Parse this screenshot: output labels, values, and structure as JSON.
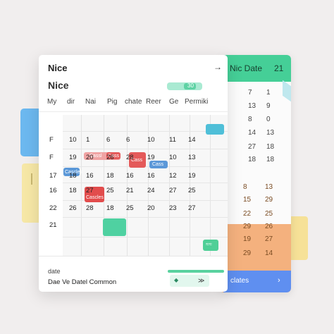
{
  "title": "Nice",
  "subtitle": "Nice",
  "header_arrow": "→",
  "pill_text": "30",
  "weekdays": [
    "My",
    "dir",
    "Nai",
    "Pig",
    "chate",
    "Reer",
    "Ge",
    "Permiki"
  ],
  "rows": [
    [
      "F",
      "10",
      "1",
      "6",
      "6",
      "10",
      "11",
      "14"
    ],
    [
      "F",
      "19",
      "20",
      "26",
      "28",
      "19",
      "10",
      "13"
    ],
    [
      "17",
      "18",
      "16",
      "18",
      "16",
      "16",
      "12",
      "19"
    ],
    [
      "16",
      "18",
      "27",
      "25",
      "21",
      "24",
      "27",
      "25"
    ],
    [
      "22",
      "26",
      "28",
      "18",
      "25",
      "20",
      "23",
      "27"
    ],
    [
      "21",
      "",
      "",
      "",
      "",
      "",
      "",
      ""
    ]
  ],
  "events": [
    {
      "label": "Cassl",
      "color": "#f0a3a3"
    },
    {
      "label": "Cass",
      "color": "#e45a5a"
    },
    {
      "label": "Cass",
      "color": "#e45a5a"
    },
    {
      "label": "Cass",
      "color": "#5b98d8"
    },
    {
      "label": "Cascles",
      "color": "#5b98d8"
    },
    {
      "label": "Cascles",
      "color": "#e24c4c"
    },
    {
      "label": "",
      "color": "#4fd1a1"
    },
    {
      "label": "",
      "color": "#4fbfd8"
    }
  ],
  "footer": {
    "date_label": "date",
    "text": "Dae Ve Datel Common",
    "chip_left": "◆",
    "chip_right": "≫"
  },
  "small_chip": "≈≈",
  "right_panel": {
    "title": "Nic Date",
    "number": "21",
    "arrow": "▸",
    "cta": "clates",
    "cta_arrow": "›",
    "col_a": [
      "7",
      "13",
      "8",
      "14",
      "27",
      "18"
    ],
    "col_b": [
      "1",
      "9",
      "0",
      "13",
      "18",
      "18"
    ],
    "col_a_orange": [
      "8",
      "15",
      "22",
      "29",
      "19",
      "29"
    ],
    "col_b_orange": [
      "13",
      "29",
      "25",
      "26",
      "27",
      "14"
    ]
  },
  "colors": {
    "accent_green": "#45cf97",
    "accent_orange": "#f4b17e",
    "accent_blue": "#5f8ff0",
    "event_red": "#e45a5a"
  }
}
